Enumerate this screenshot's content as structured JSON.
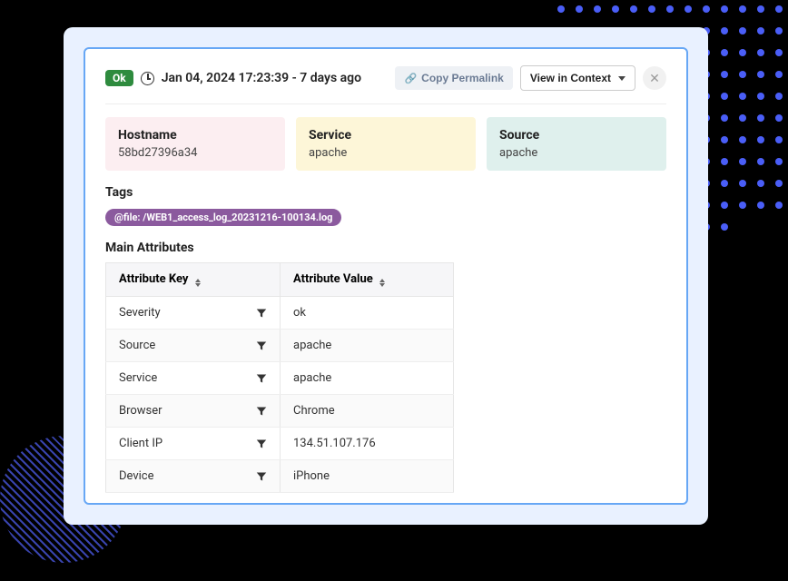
{
  "header": {
    "status_badge": "Ok",
    "timestamp": "Jan 04, 2024 17:23:39 - 7 days ago",
    "copy_permalink": "Copy Permalink",
    "view_in_context": "View in Context"
  },
  "cards": {
    "hostname_label": "Hostname",
    "hostname_value": "58bd27396a34",
    "service_label": "Service",
    "service_value": "apache",
    "source_label": "Source",
    "source_value": "apache"
  },
  "tags": {
    "title": "Tags",
    "items": [
      "@file: /WEB1_access_log_20231216-100134.log"
    ]
  },
  "attributes": {
    "title": "Main Attributes",
    "col_key": "Attribute Key",
    "col_value": "Attribute Value",
    "rows": [
      {
        "key": "Severity",
        "value": "ok"
      },
      {
        "key": "Source",
        "value": "apache"
      },
      {
        "key": "Service",
        "value": "apache"
      },
      {
        "key": "Browser",
        "value": "Chrome"
      },
      {
        "key": "Client IP",
        "value": "134.51.107.176"
      },
      {
        "key": "Device",
        "value": "iPhone"
      }
    ]
  }
}
